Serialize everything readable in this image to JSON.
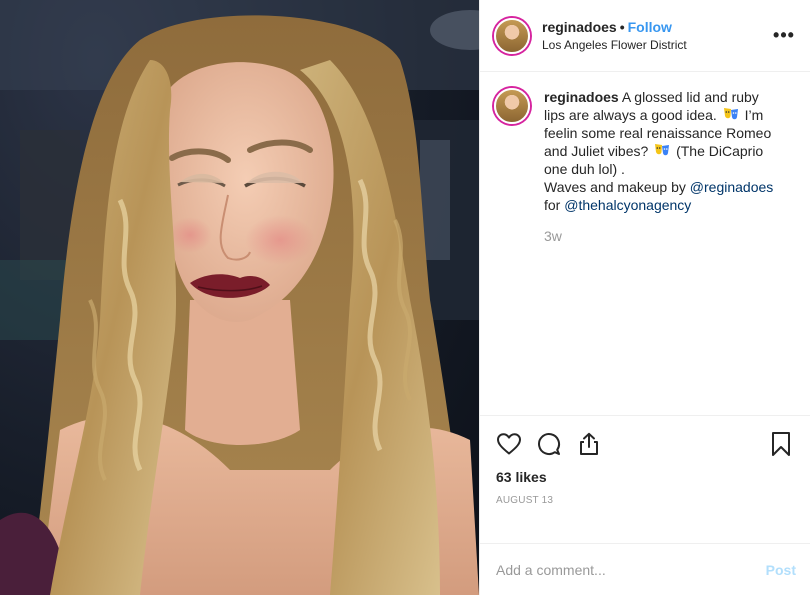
{
  "post": {
    "username": "reginadoes",
    "follow_label": "Follow",
    "separator": "•",
    "location": "Los Angeles Flower District",
    "more_label": "•••",
    "caption": {
      "username": "reginadoes",
      "line1": "A glossed lid and ruby lips are always a good idea.",
      "line2": "I’m feelin some real renaissance Romeo and Juliet vibes?",
      "line3": "(The DiCaprio one duh lol) .",
      "line4_prefix": "Waves and makeup by",
      "mention1": "@reginadoes",
      "line5_prefix": "for",
      "mention2": "@thehalcyonagency",
      "emoji": "theater-masks-icon"
    },
    "time_ago": "3w",
    "likes": "63 likes",
    "date": "AUGUST 13",
    "comment_placeholder": "Add a comment...",
    "post_label": "Post"
  },
  "colors": {
    "link": "#3897f0",
    "mention": "#003569",
    "muted": "#999999",
    "post_disabled": "#b2dffc",
    "border": "#efefef"
  }
}
